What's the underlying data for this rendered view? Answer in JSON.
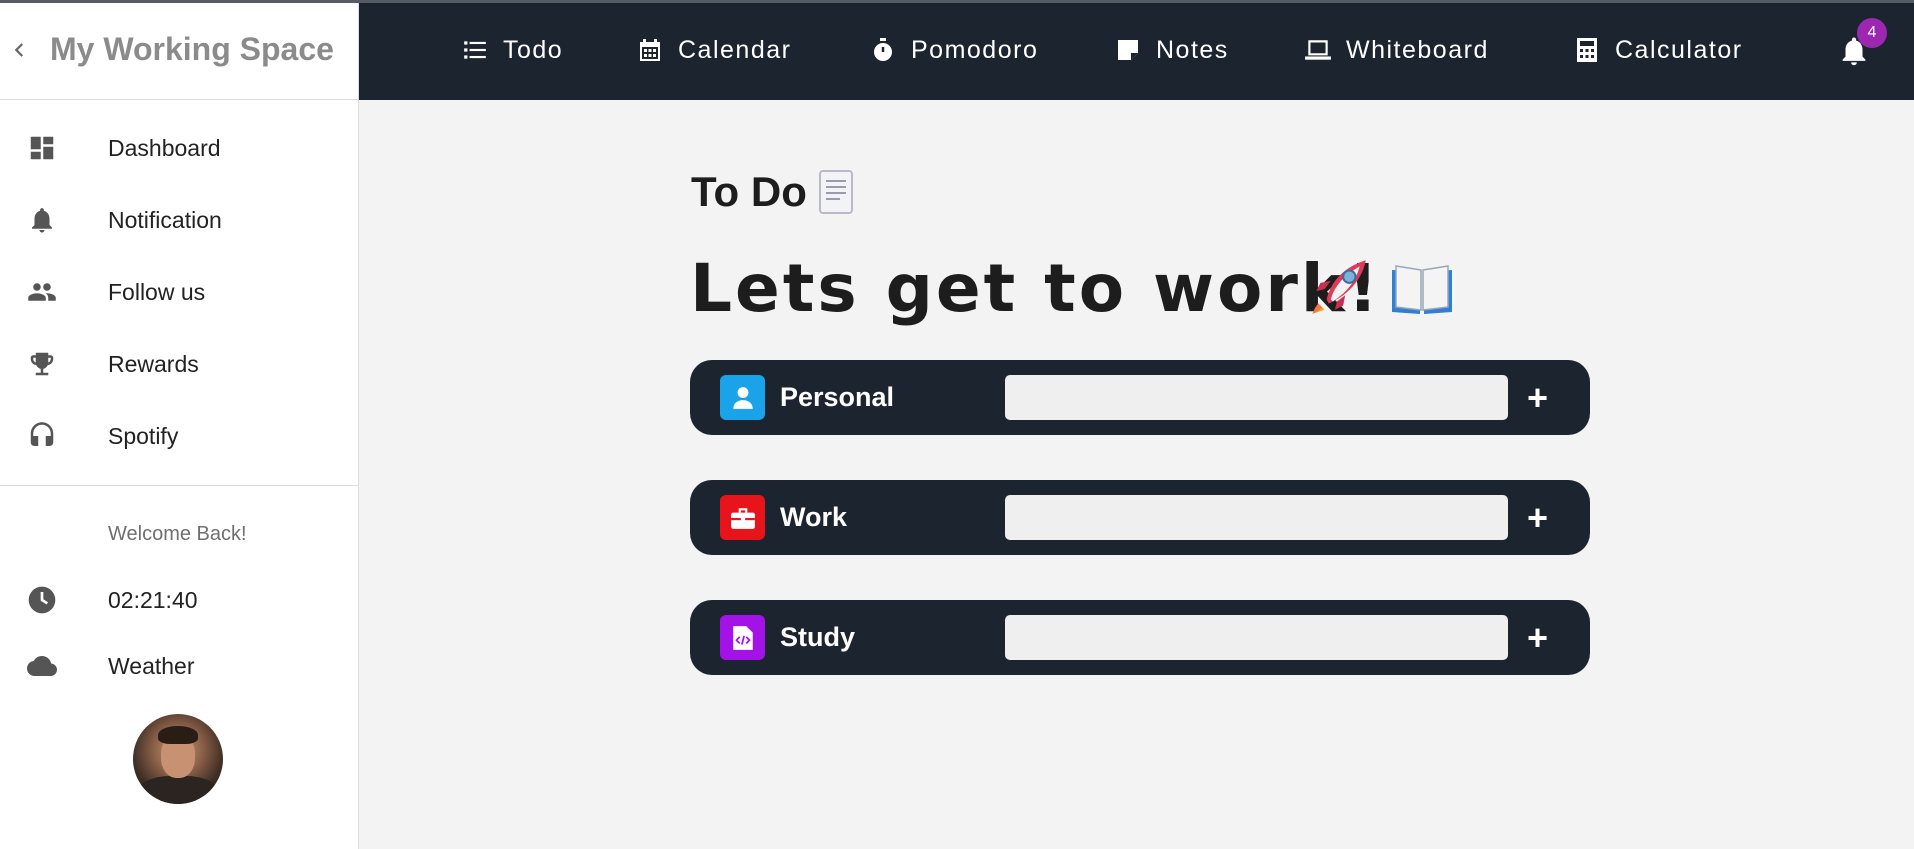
{
  "sidebar": {
    "title": "My Working Space",
    "items": [
      {
        "label": "Dashboard",
        "icon": "dashboard-icon"
      },
      {
        "label": "Notification",
        "icon": "bell-icon"
      },
      {
        "label": "Follow us",
        "icon": "people-icon"
      },
      {
        "label": "Rewards",
        "icon": "trophy-icon"
      },
      {
        "label": "Spotify",
        "icon": "headphones-icon"
      }
    ],
    "welcome": "Welcome Back!",
    "time": "02:21:40",
    "weather": "Weather"
  },
  "topbar": {
    "tabs": [
      {
        "label": "Todo",
        "icon": "list-icon"
      },
      {
        "label": "Calendar",
        "icon": "calendar-icon"
      },
      {
        "label": "Pomodoro",
        "icon": "stopwatch-icon"
      },
      {
        "label": "Notes",
        "icon": "note-icon"
      },
      {
        "label": "Whiteboard",
        "icon": "laptop-icon"
      },
      {
        "label": "Calculator",
        "icon": "calculator-icon"
      }
    ],
    "notification_count": "4"
  },
  "main": {
    "title": "To Do",
    "headline": "Lets get to work!",
    "categories": [
      {
        "label": "Personal",
        "icon": "person-icon",
        "color": "#1aa3e8",
        "input_value": ""
      },
      {
        "label": "Work",
        "icon": "briefcase-icon",
        "color": "#e8141b",
        "input_value": ""
      },
      {
        "label": "Study",
        "icon": "code-file-icon",
        "color": "#a313e8",
        "input_value": ""
      }
    ],
    "add_label": "+"
  },
  "colors": {
    "dark": "#1c2430",
    "badge": "#9c27b0",
    "background": "#f3f3f3"
  }
}
